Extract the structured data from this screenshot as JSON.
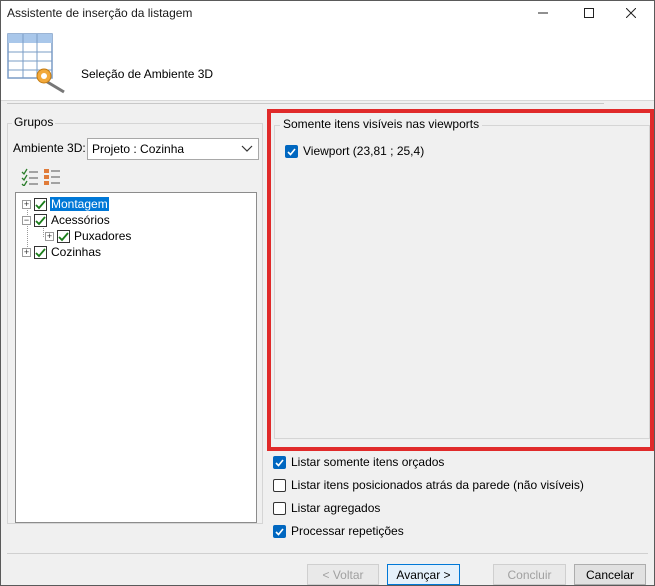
{
  "window": {
    "title": "Assistente de inserção da listagem"
  },
  "header": {
    "step_title": "Seleção de Ambiente 3D"
  },
  "groups": {
    "label": "Grupos",
    "environment_label": "Ambiente 3D:",
    "environment_value": "Projeto : Cozinha",
    "tree": [
      {
        "label": "Montagem",
        "checked": true,
        "selected": true,
        "level": 0
      },
      {
        "label": "Acessórios",
        "checked": true,
        "selected": false,
        "level": 0
      },
      {
        "label": "Puxadores",
        "checked": true,
        "selected": false,
        "level": 1
      },
      {
        "label": "Cozinhas",
        "checked": true,
        "selected": false,
        "level": 0
      }
    ]
  },
  "viewports": {
    "label": "Somente itens visíveis nas viewports",
    "items": [
      {
        "label": "Viewport (23,81 ; 25,4)",
        "checked": true
      }
    ]
  },
  "options": [
    {
      "label": "Listar somente itens orçados",
      "checked": true
    },
    {
      "label": "Listar itens posicionados atrás da parede (não visíveis)",
      "checked": false
    },
    {
      "label": "Listar agregados",
      "checked": false
    },
    {
      "label": "Processar repetições",
      "checked": true
    }
  ],
  "buttons": {
    "back": "< Voltar",
    "next": "Avançar >",
    "finish": "Concluir",
    "cancel": "Cancelar"
  },
  "colors": {
    "accent": "#0067c0",
    "highlight": "#e02a2a",
    "selection": "#0078d7"
  }
}
